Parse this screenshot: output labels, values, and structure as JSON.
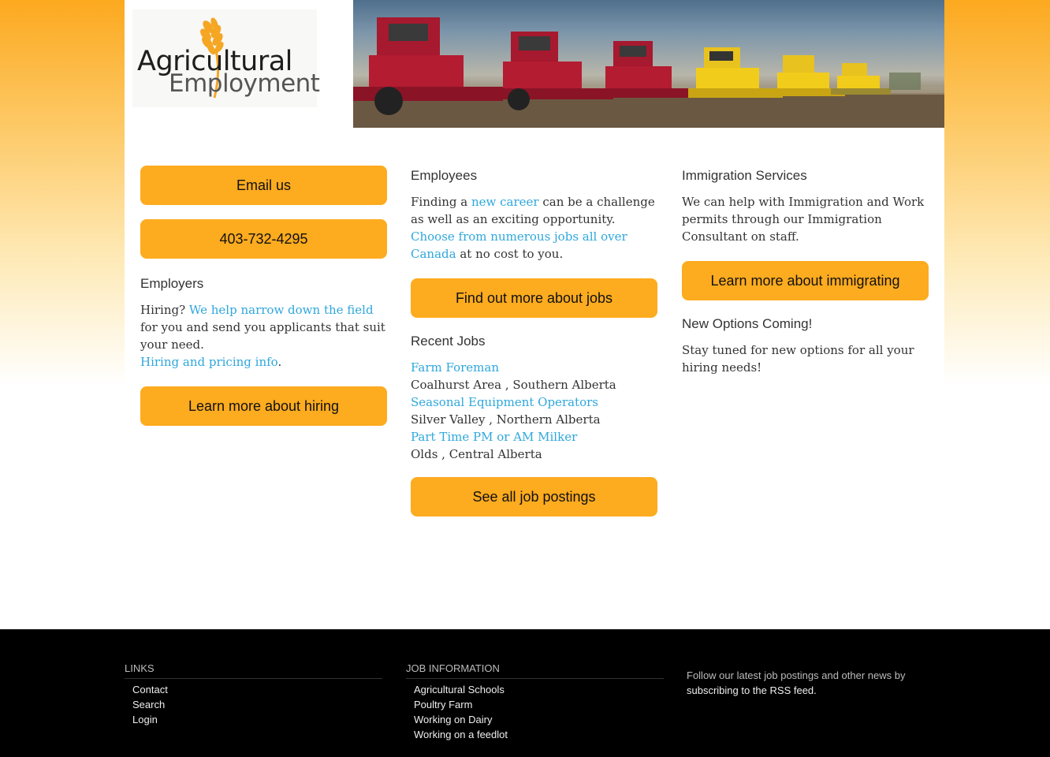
{
  "logo": {
    "line1": "Agricultural",
    "line2": "Employment"
  },
  "colors": {
    "accent": "#fdab1f",
    "link": "#2ea7dc",
    "footer_bg": "#000000"
  },
  "col1": {
    "email_button": "Email us",
    "phone_button": "403-732-4295",
    "employers_heading": "Employers",
    "hiring_text_1": "Hiring? ",
    "hiring_link": "We help narrow down the field",
    "hiring_text_2": " for you and send you applicants that suit your need.",
    "pricing_link": "Hiring and pricing info",
    "pricing_period": ".",
    "hiring_button": "Learn more about hiring"
  },
  "col2": {
    "employees_heading": "Employees",
    "text_1": "Finding a ",
    "link_1": "new career",
    "text_2": " can be a challenge as well as an exciting opportunity. ",
    "link_2": "Choose from numerous jobs all over Canada",
    "text_3": " at no cost to you.",
    "jobs_button": "Find out more about jobs",
    "recent_heading": "Recent Jobs",
    "jobs": [
      {
        "title": "Farm Foreman",
        "location": "Coalhurst Area , Southern Alberta"
      },
      {
        "title": "Seasonal Equipment Operators",
        "location": "Silver Valley , Northern Alberta"
      },
      {
        "title": "Part Time PM or AM Milker",
        "location": "Olds , Central Alberta"
      }
    ],
    "all_jobs_button": "See all job postings"
  },
  "col3": {
    "immigration_heading": "Immigration Services",
    "immigration_text": "We can help with Immigration and Work permits through our Immigration Consultant on staff.",
    "immigration_button": "Learn more about immigrating",
    "new_options_heading": "New Options Coming!",
    "new_options_text": "Stay tuned for new options for all your hiring needs!"
  },
  "footer": {
    "links_heading": "LINKS",
    "links": [
      "Contact",
      "Search",
      "Login"
    ],
    "jobinfo_heading": "JOB INFORMATION",
    "jobinfo": [
      "Agricultural Schools",
      "Poultry Farm",
      "Working on Dairy",
      "Working on a feedlot"
    ],
    "rss_text": "Follow our latest job postings and other news by ",
    "rss_link": "subscribing to the RSS feed."
  }
}
